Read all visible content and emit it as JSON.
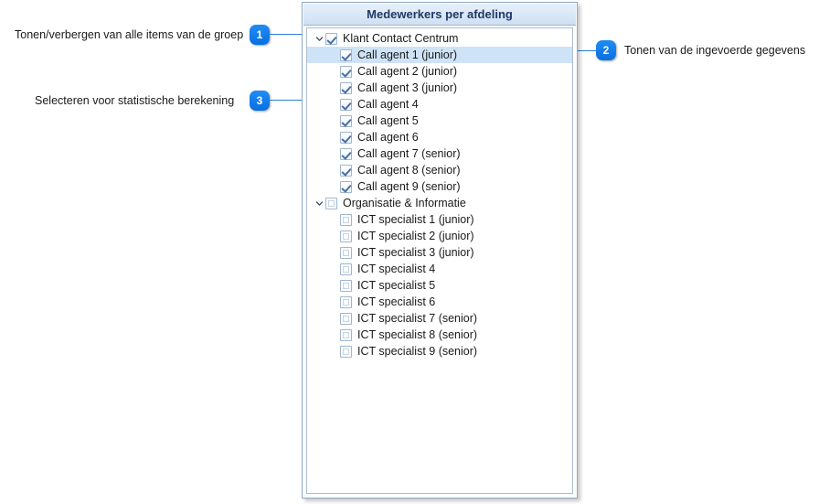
{
  "panel": {
    "title": "Medewerkers per afdeling",
    "groups": [
      {
        "label": "Klant Contact Centrum",
        "checked": true,
        "expanded": true,
        "items": [
          {
            "label": "Call agent 1 (junior)",
            "checked": true,
            "selected": true
          },
          {
            "label": "Call agent 2 (junior)",
            "checked": true,
            "selected": false
          },
          {
            "label": "Call agent 3 (junior)",
            "checked": true,
            "selected": false
          },
          {
            "label": "Call agent 4",
            "checked": true,
            "selected": false
          },
          {
            "label": "Call agent 5",
            "checked": true,
            "selected": false
          },
          {
            "label": "Call agent 6",
            "checked": true,
            "selected": false
          },
          {
            "label": "Call agent 7 (senior)",
            "checked": true,
            "selected": false
          },
          {
            "label": "Call agent 8 (senior)",
            "checked": true,
            "selected": false
          },
          {
            "label": "Call agent 9 (senior)",
            "checked": true,
            "selected": false
          }
        ]
      },
      {
        "label": "Organisatie & Informatie",
        "checked": false,
        "expanded": true,
        "items": [
          {
            "label": "ICT specialist 1 (junior)",
            "checked": false,
            "selected": false
          },
          {
            "label": "ICT specialist 2 (junior)",
            "checked": false,
            "selected": false
          },
          {
            "label": "ICT specialist 3 (junior)",
            "checked": false,
            "selected": false
          },
          {
            "label": "ICT specialist 4",
            "checked": false,
            "selected": false
          },
          {
            "label": "ICT specialist 5",
            "checked": false,
            "selected": false
          },
          {
            "label": "ICT specialist 6",
            "checked": false,
            "selected": false
          },
          {
            "label": "ICT specialist 7 (senior)",
            "checked": false,
            "selected": false
          },
          {
            "label": "ICT specialist 8 (senior)",
            "checked": false,
            "selected": false
          },
          {
            "label": "ICT specialist 9 (senior)",
            "checked": false,
            "selected": false
          }
        ]
      }
    ]
  },
  "annotations": [
    {
      "number": "1",
      "text": "Tonen/verbergen van alle items van de groep"
    },
    {
      "number": "2",
      "text": "Tonen van de ingevoerde gegevens"
    },
    {
      "number": "3",
      "text": "Selecteren voor statistische berekening"
    }
  ],
  "colors": {
    "badge": "#0a6fe0",
    "leader": "#2a7fd4",
    "selection": "#cfe3f7",
    "title_text": "#1f3864"
  }
}
